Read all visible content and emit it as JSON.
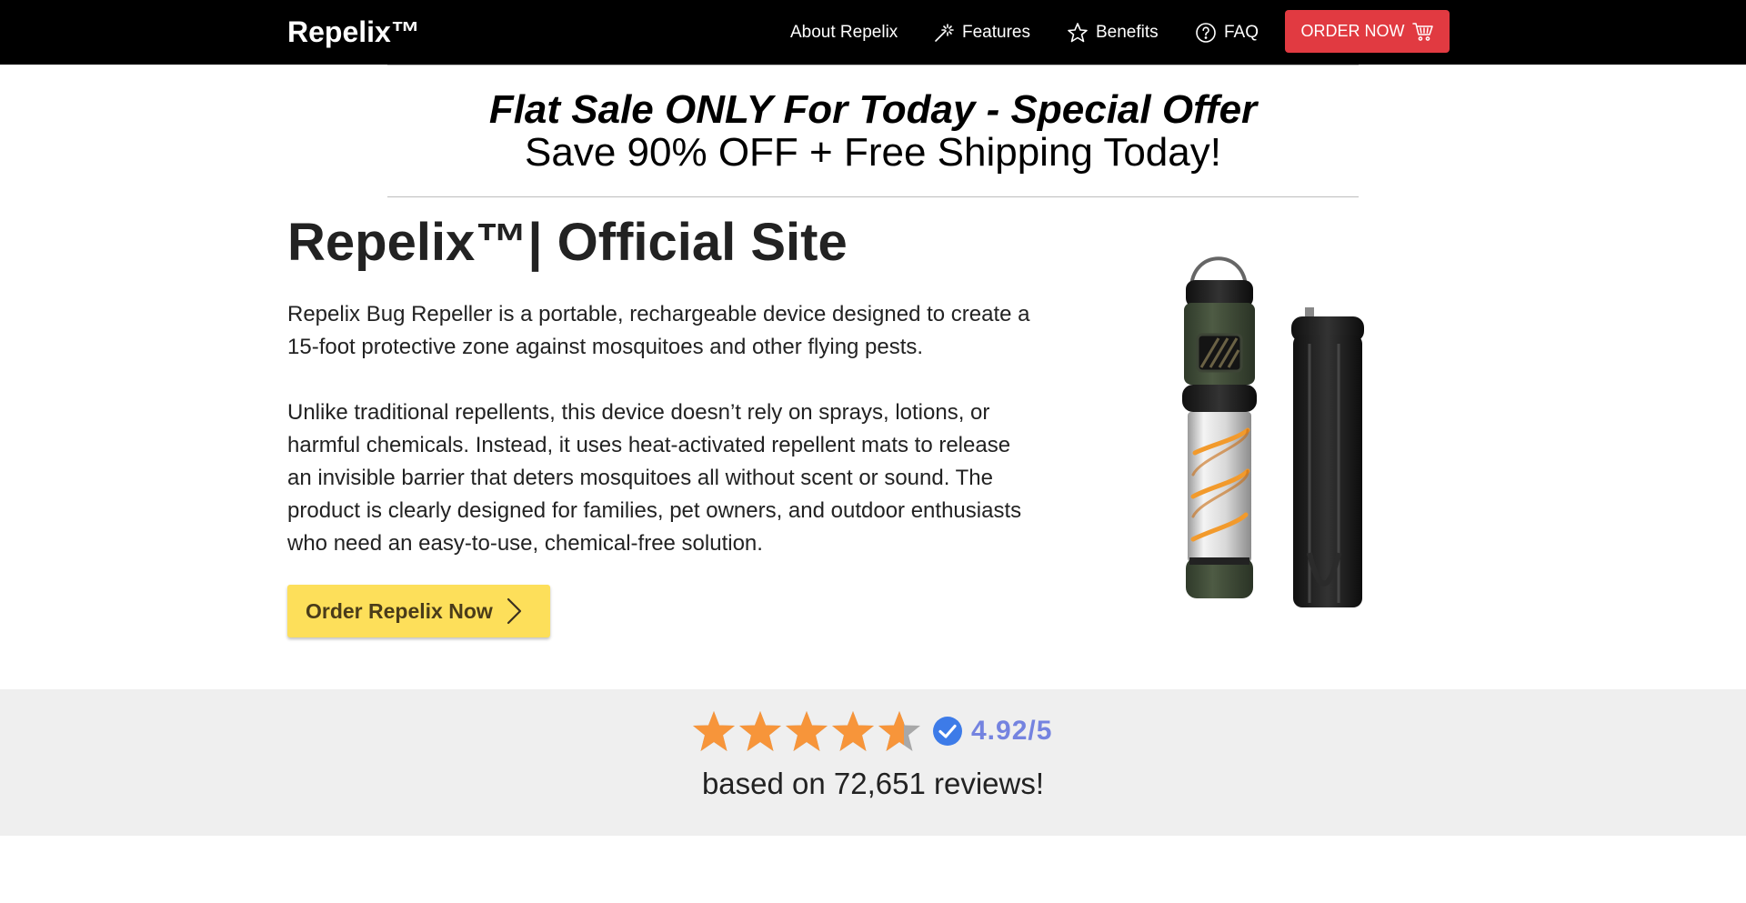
{
  "nav": {
    "brand": "Repelix™",
    "items": [
      {
        "label": "About Repelix",
        "icon": "none"
      },
      {
        "label": "Features",
        "icon": "magic-wand-icon"
      },
      {
        "label": "Benefits",
        "icon": "star-icon"
      },
      {
        "label": "FAQ",
        "icon": "question-circle-icon"
      }
    ],
    "order_label": "ORDER NOW",
    "order_icon": "cart-icon"
  },
  "promo": {
    "line1": "Flat Sale ONLY For Today - Special Offer",
    "line2": "Save 90% OFF + Free Shipping Today!"
  },
  "hero": {
    "title": "Repelix™| Official Site",
    "paragraph1": "Repelix Bug Repeller is a portable, rechargeable device designed to create a 15-foot protective zone against mosquitoes and other flying pests.",
    "paragraph2": "Unlike traditional repellents, this device doesn’t rely on sprays, lotions, or harmful chemicals. Instead, it uses heat-activated repellent mats to release an invisible barrier that deters mosquitoes all without scent or sound. The product is clearly designed for families, pet owners, and outdoor enthusiasts who need an easy-to-use, chemical-free solution.",
    "cta_label": "Order Repelix Now",
    "image": "product-image"
  },
  "rating": {
    "stars_filled": 4.6,
    "stars_total": 5,
    "score": "4.92/5",
    "reviews": "based on 72,651 reviews!"
  },
  "colors": {
    "navbar": "#000000",
    "order_button": "#e13a41",
    "cta": "#fddf5a",
    "star": "#f7953a",
    "score": "#7483e0",
    "band": "#efefef"
  }
}
